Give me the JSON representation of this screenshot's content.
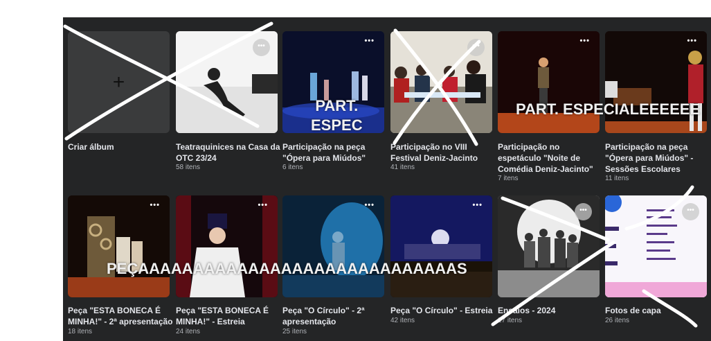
{
  "albums": [
    {
      "title": "Criar álbum",
      "count": ""
    },
    {
      "title": "Teatraquinices na Casa da OTC 23/24",
      "count": "58 itens"
    },
    {
      "title": "Participação na peça \"Ópera para Miúdos\"",
      "count": "6 itens"
    },
    {
      "title": "Participação no VIII Festival Deniz-Jacinto",
      "count": "41 itens"
    },
    {
      "title": "Participação no espetáculo \"Noite de Comédia Deniz-Jacinto\"",
      "count": "7 itens"
    },
    {
      "title": "Participação na peça \"Ópera para Miúdos\" - Sessões Escolares",
      "count": "11 itens"
    },
    {
      "title": "Peça \"ESTA BONECA É MINHA!\" - 2ª apresentação",
      "count": "18 itens"
    },
    {
      "title": "Peça \"ESTA BONECA É MINHA!\" - Estreia",
      "count": "24 itens"
    },
    {
      "title": "Peça \"O Círculo\" - 2ª apresentação",
      "count": "25 itens"
    },
    {
      "title": "Peça \"O Círculo\" - Estreia",
      "count": "42 itens"
    },
    {
      "title": "Ensaios - 2024",
      "count": "27 itens"
    },
    {
      "title": "Fotos de capa",
      "count": "26 itens"
    }
  ],
  "menu_glyph": "•••",
  "create_glyph": "+",
  "annotations": {
    "part_espec": "PART.\nESPEC",
    "part_especial": "PART. ESPECIALEEEEEE",
    "pecas": "PEÇAAAAAAAAAAAAAAAAAAAAAAAAAAAAAS"
  },
  "colors": {
    "panel": "#242526",
    "tab_indicator": "#2d88ff",
    "scribble": "#ffffff"
  }
}
